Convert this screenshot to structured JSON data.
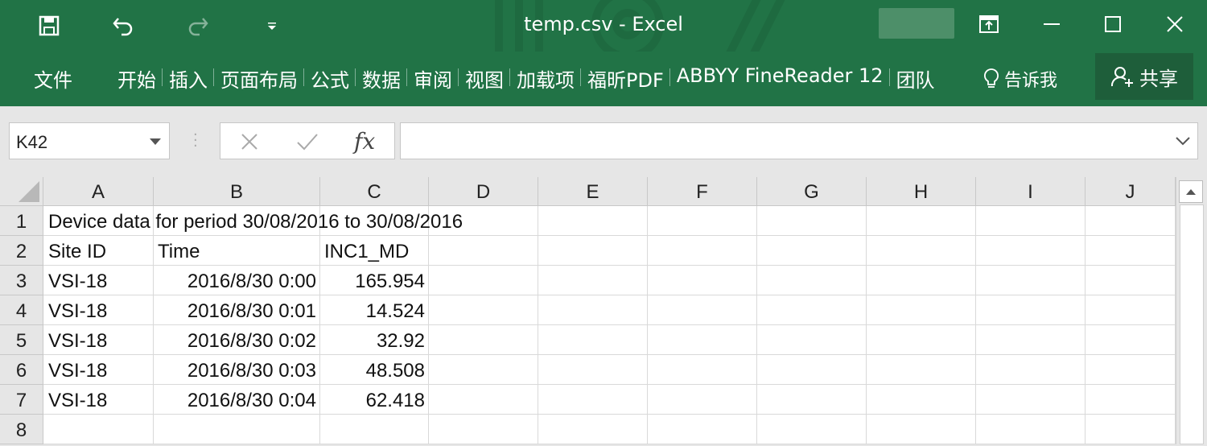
{
  "window": {
    "title": "temp.csv  -  Excel",
    "quick_access": {
      "save_icon": "save-icon",
      "undo_icon": "undo-icon",
      "redo_icon": "redo-icon",
      "customize_icon": "customize-dropdown-icon"
    },
    "controls": [
      "ribbon-display-icon",
      "minimize-icon",
      "maximize-icon",
      "close-icon"
    ]
  },
  "ribbon": {
    "file_tab": "文件",
    "tabs": [
      "开始",
      "插入",
      "页面布局",
      "公式",
      "数据",
      "审阅",
      "视图",
      "加载项",
      "福昕PDF",
      "ABBYY FineReader 12",
      "团队"
    ],
    "tell_me": "告诉我",
    "share": "共享"
  },
  "formula_bar": {
    "name_box": "K42",
    "formula_value": ""
  },
  "sheet": {
    "columns": [
      "A",
      "B",
      "C",
      "D",
      "E",
      "F",
      "G",
      "H",
      "I",
      "J"
    ],
    "rows": [
      "1",
      "2",
      "3",
      "4",
      "5",
      "6",
      "7",
      "8"
    ],
    "row1_text": "Device data for period 30/08/2016 to 30/08/2016",
    "headers": [
      "Site ID",
      "Time",
      "INC1_MD"
    ],
    "data": [
      [
        "VSI-18",
        "2016/8/30 0:00",
        "165.954"
      ],
      [
        "VSI-18",
        "2016/8/30 0:01",
        "14.524"
      ],
      [
        "VSI-18",
        "2016/8/30 0:02",
        "32.92"
      ],
      [
        "VSI-18",
        "2016/8/30 0:03",
        "48.508"
      ],
      [
        "VSI-18",
        "2016/8/30 0:04",
        "62.418"
      ]
    ]
  }
}
